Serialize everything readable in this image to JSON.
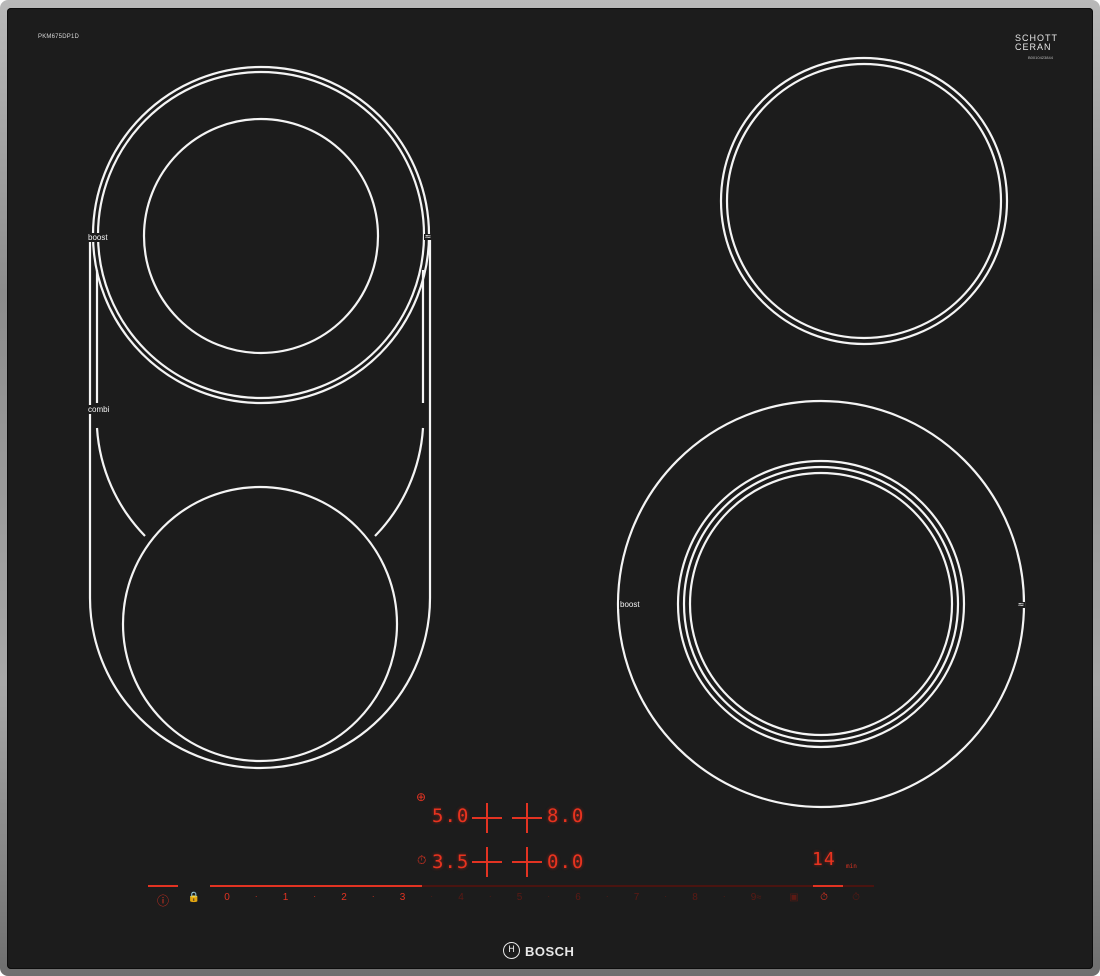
{
  "appliance": {
    "model_label": "PKM675DP1D",
    "glass_brand_line1": "SCHOTT",
    "glass_brand_line2": "CERAN",
    "glass_serial": "B0010423844",
    "brand": "BOSCH"
  },
  "zones": {
    "front_left_labels": {
      "boost": "boost",
      "combi": "combi"
    },
    "right_front_label": "boost",
    "boost_symbol": "≈"
  },
  "displays": {
    "row1": {
      "left_value": "5.0",
      "right_value": "8.0",
      "icon": "timer-chef-icon"
    },
    "row2": {
      "left_value": "3.5",
      "right_value": "0.0",
      "icon": "timer-icon"
    },
    "timer_value": "14",
    "timer_unit": "min"
  },
  "controls": {
    "power_symbol": "ⓘ",
    "power_icon": "power-icon",
    "childlock_icon": "child-lock-icon",
    "levels": [
      "0",
      "1",
      "2",
      "3",
      "4",
      "5",
      "6",
      "7",
      "8",
      "9"
    ],
    "level_ticks": [
      "·",
      "·",
      "·",
      "·",
      "·",
      "·",
      "·",
      "·",
      "·"
    ],
    "selected_level_fraction": 0.32,
    "extra_icons": [
      "boost-icon",
      "wipe-protect-icon",
      "timer-select-icon",
      "stopwatch-icon"
    ],
    "accent_color": "#e23322"
  }
}
